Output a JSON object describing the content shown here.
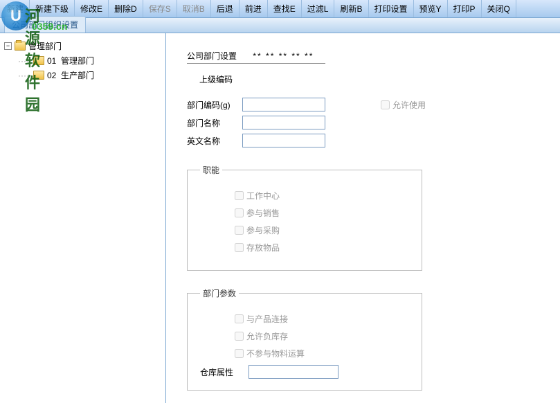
{
  "watermark": {
    "big": "河源软件园",
    "sub": "0359.cn",
    "circle": "U"
  },
  "toolbar": [
    {
      "label": "新建",
      "disabled": false
    },
    {
      "label": "新建下级",
      "disabled": false
    },
    {
      "label": "修改E",
      "disabled": false
    },
    {
      "label": "删除D",
      "disabled": false
    },
    {
      "label": "保存S",
      "disabled": true
    },
    {
      "label": "取消B",
      "disabled": true
    },
    {
      "label": "后退",
      "disabled": false
    },
    {
      "label": "前进",
      "disabled": false
    },
    {
      "label": "查找E",
      "disabled": false
    },
    {
      "label": "过滤L",
      "disabled": false
    },
    {
      "label": "刷新B",
      "disabled": false
    },
    {
      "label": "打印设置",
      "disabled": false
    },
    {
      "label": "预览Y",
      "disabled": false
    },
    {
      "label": "打印P",
      "disabled": false
    },
    {
      "label": "关闭Q",
      "disabled": false
    }
  ],
  "tab": {
    "label": "公司部门组织设置"
  },
  "tree": {
    "root": "管理部门",
    "children": [
      {
        "code": "01",
        "name": "管理部门"
      },
      {
        "code": "02",
        "name": "生产部门"
      }
    ]
  },
  "form": {
    "title": "公司部门设置",
    "stars": "** ** ** ** **",
    "parent_code_label": "上级编码",
    "fields": {
      "code_label": "部门编码(g)",
      "code_value": "",
      "name_label": "部门名称",
      "name_value": "",
      "ename_label": "英文名称",
      "ename_value": "",
      "allow_use_label": "允许使用"
    },
    "functions": {
      "legend": "职能",
      "items": [
        "工作中心",
        "参与销售",
        "参与采购",
        "存放物品"
      ]
    },
    "params": {
      "legend": "部门参数",
      "items": [
        "与产品连接",
        "允许负库存",
        "不参与物料运算"
      ],
      "warehouse_label": "仓库属性",
      "warehouse_value": ""
    }
  }
}
